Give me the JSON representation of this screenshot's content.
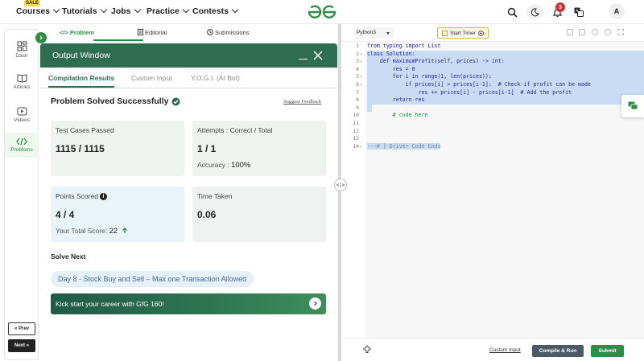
{
  "topnav": {
    "sale_badge": "SALE",
    "items": [
      "Courses",
      "Tutorials",
      "Jobs",
      "Practice",
      "Contests"
    ],
    "notification_count": "3",
    "avatar_initial": "A"
  },
  "rail": {
    "items": [
      {
        "label": "Dash",
        "icon": "dashboard-icon"
      },
      {
        "label": "Articles",
        "icon": "book-icon"
      },
      {
        "label": "Videos",
        "icon": "video-icon"
      },
      {
        "label": "Problems",
        "icon": "code-icon"
      }
    ],
    "prev_label": "« Prev",
    "next_label": "Next »"
  },
  "problem_tabs": {
    "problem": "</> Problem",
    "editorial": "Editorial",
    "submissions": "Submissions"
  },
  "output_window": {
    "title": "Output Window",
    "tabs": [
      "Compilation Results",
      "Custom Input",
      "Y.O.G.I. (AI Bot)"
    ],
    "status": "Problem Solved Successfully",
    "feedback": "Suggest Feedback",
    "cards": {
      "testcases_label": "Test Cases Passed",
      "testcases_value": "1115 / 1115",
      "attempts_label": "Attempts : Correct / Total",
      "attempts_value": "1 / 1",
      "accuracy_label": "Accuracy :",
      "accuracy_value": "100%",
      "points_label": "Points Scored",
      "points_value": "4 / 4",
      "total_score_label": "Your Total Score:",
      "total_score_value": "22",
      "time_label": "Time Taken",
      "time_value": "0.06"
    },
    "solve_next_heading": "Solve Next",
    "next_problem": "Day 8 - Stock Buy and Sell – Max one Transaction Allowed",
    "banner": "Kick start your career with GfG 160!"
  },
  "editor": {
    "language": "Python3",
    "timer_label": "Start Timer",
    "line_numbers": [
      "1",
      "2",
      "3",
      "4",
      "5",
      "6",
      "7",
      "8",
      "9",
      "10",
      "11",
      "12",
      "13",
      "14"
    ],
    "code": {
      "l1": "from typing import List",
      "l2": "class Solution:",
      "l3": "    def maximumProfit(self, prices) -> int:",
      "l4": "        res = 0",
      "l5": "        for i in range(1, len(prices)):",
      "l6": "            if prices[i] > prices[i-1]:  # Check if profit can be made",
      "l7": "                res += prices[i] - prices[i-1]  # Add the profit",
      "l8": "        return res",
      "l9": "",
      "l10": "        # code here",
      "l14": "# } Driver Code Ends"
    },
    "custom_input": "Custom Input",
    "compile_run": "Compile & Run",
    "submit": "Submit"
  },
  "colors": {
    "brand_green": "#2f8d46",
    "window_header": "#2f6d51",
    "selection": "#c8dcf4"
  }
}
